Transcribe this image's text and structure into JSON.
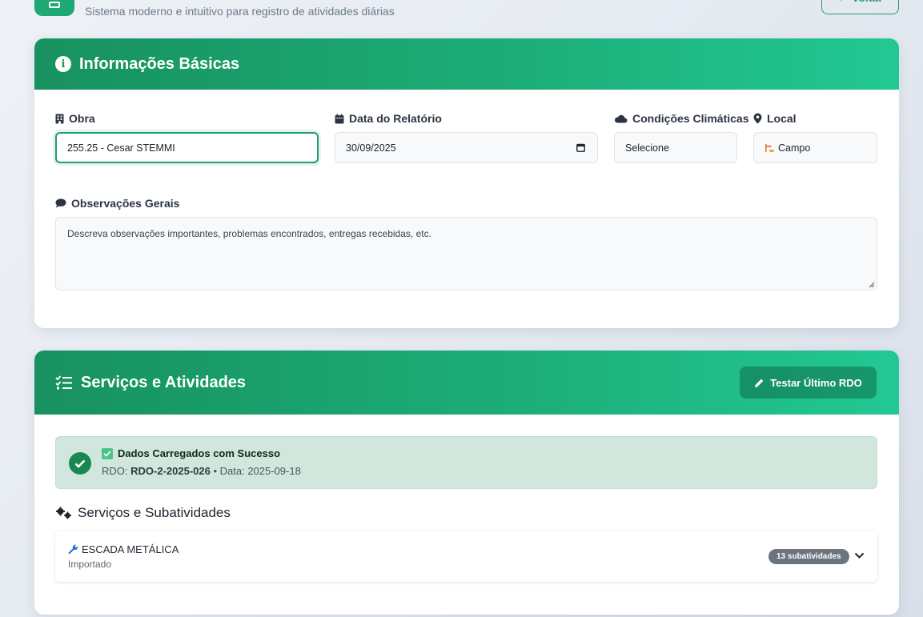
{
  "header": {
    "subtitle": "Sistema moderno e intuitivo para registro de atividades diárias",
    "back_label": "← Voltar"
  },
  "basic_info": {
    "title": "Informações Básicas",
    "obra": {
      "label": "Obra",
      "value": "255.25 - Cesar STEMMI"
    },
    "data": {
      "label": "Data do Relatório",
      "value": "30/09/2025"
    },
    "clima": {
      "label": "Condições Climáticas",
      "value": "Selecione"
    },
    "local": {
      "label": "Local",
      "value": "Campo"
    },
    "observacoes": {
      "label": "Observações Gerais",
      "placeholder": "Descreva observações importantes, problemas encontrados, entregas recebidas, etc."
    }
  },
  "services": {
    "title": "Serviços e Atividades",
    "test_button": "Testar Último RDO",
    "alert": {
      "title": "Dados Carregados com Sucesso",
      "rdo_prefix": "RDO:",
      "rdo_value": "RDO-2-2025-026",
      "date_text": "• Data: 2025-09-18"
    },
    "section_title": "Serviços e Subatividades",
    "items": [
      {
        "name": "ESCADA METÁLICA",
        "status": "Importado",
        "badge": "13 subatividades"
      }
    ]
  },
  "colors": {
    "accent": "#1f9d6e",
    "header_start": "#17915f",
    "header_end": "#22c893",
    "alert_bg": "#d1e7dd"
  },
  "icons": [
    "building-icon",
    "calendar-icon",
    "cloud-icon",
    "map-pin-icon",
    "comment-icon",
    "info-icon",
    "tasks-icon",
    "pencil-icon",
    "check-circle-icon",
    "checkbox-icon",
    "cogs-icon",
    "wrench-icon",
    "chevron-down-icon"
  ]
}
